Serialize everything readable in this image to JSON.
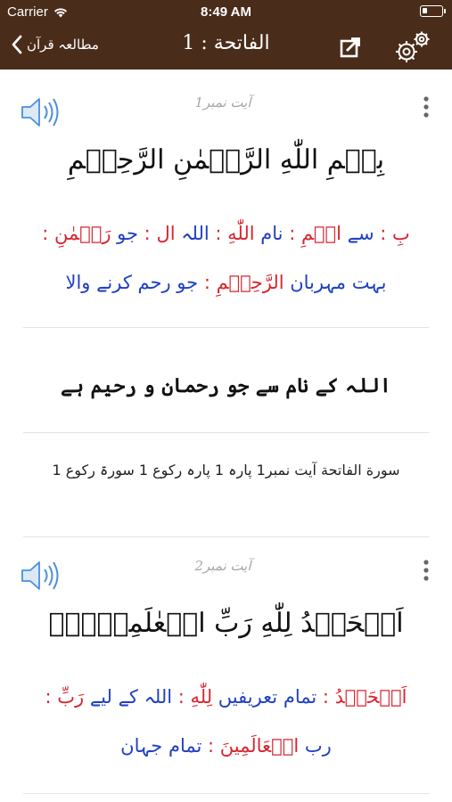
{
  "status_bar": {
    "carrier": "Carrier",
    "time": "8:49 AM",
    "battery_level": 0.25
  },
  "nav": {
    "back_label": "مطالعہ قرآن",
    "title": "الفاتحة : 1",
    "share_icon": "share-icon",
    "settings_icon": "gear-icon"
  },
  "ayahs": [
    {
      "number_label": "آیت نمبر1",
      "arabic": "بِسۡمِ اللّٰهِ الرَّحۡمٰنِ الرَّحِيۡمِ",
      "word_lines": [
        [
          {
            "ar": "بِ",
            "ur": "سے"
          },
          {
            "ar": "اسۡمِ",
            "ur": "نام"
          },
          {
            "ar": "اللّٰهِ",
            "ur": "اللہ"
          },
          {
            "ar": "ال",
            "ur": "جو"
          },
          {
            "ar": "رَحۡمٰنِ",
            "ur": ""
          }
        ],
        [
          {
            "ar": "",
            "ur": "بہت مہربان"
          },
          {
            "ar": "الرَّحِيۡمِ",
            "ur": "جو رحم کرنے والا"
          }
        ]
      ],
      "translation": "اللہ کے نام سے جو رحمان و رحیم ہے",
      "reference": "سورة الفاتحة آیت نمبر1  پارہ 1 پارہ رکوع 1 سورۃ رکوع 1"
    },
    {
      "number_label": "آیت نمبر2",
      "arabic": "اَلۡحَمۡدُ لِلّٰهِ رَبِّ الۡعٰلَمِيۡنَۙ",
      "word_lines": [
        [
          {
            "ar": "اَلۡحَمۡدُ",
            "ur": "تمام تعریفیں"
          },
          {
            "ar": "لِلّٰهِ",
            "ur": "اللہ کے لیے"
          },
          {
            "ar": "رَبِّ",
            "ur": ""
          }
        ],
        [
          {
            "ar": "",
            "ur": "رب"
          },
          {
            "ar": "الۡعَالَمِينَ",
            "ur": "تمام جہان"
          }
        ]
      ]
    }
  ]
}
